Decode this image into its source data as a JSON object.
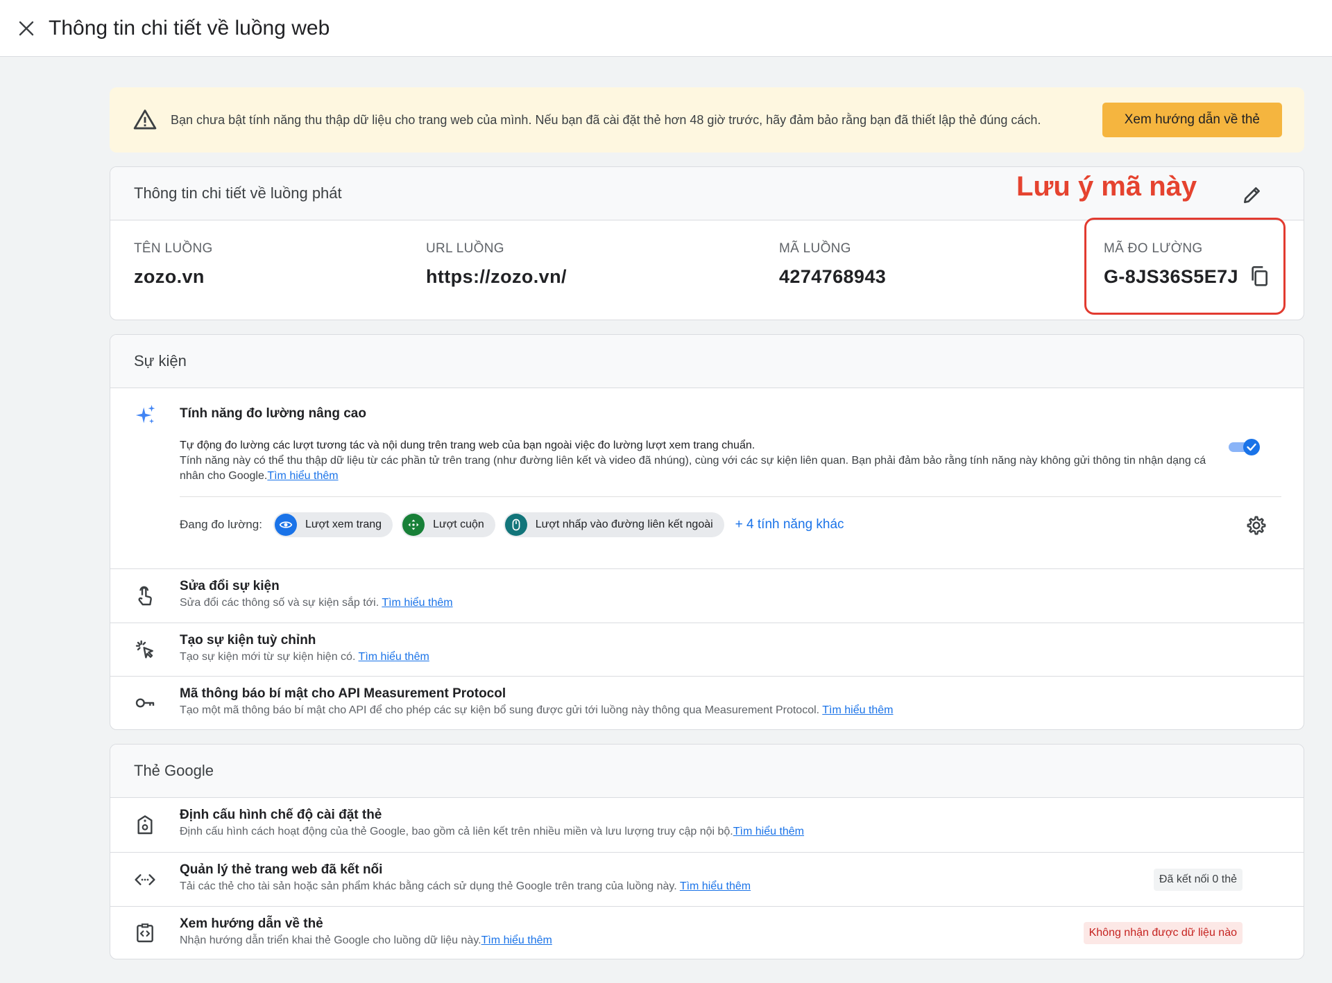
{
  "header": {
    "title": "Thông tin chi tiết về luồng web"
  },
  "banner": {
    "text": "Bạn chưa bật tính năng thu thập dữ liệu cho trang web của mình. Nếu bạn đã cài đặt thẻ hơn 48 giờ trước, hãy đảm bảo rằng bạn đã thiết lập thẻ đúng cách.",
    "button": "Xem hướng dẫn về thẻ"
  },
  "stream": {
    "title": "Thông tin chi tiết về luồng phát",
    "annotation": "Lưu ý mã này",
    "fields": [
      {
        "label": "TÊN LUỒNG",
        "value": "zozo.vn"
      },
      {
        "label": "URL LUỒNG",
        "value": "https://zozo.vn/"
      },
      {
        "label": "MÃ LUỒNG",
        "value": "4274768943"
      },
      {
        "label": "MÃ ĐO LƯỜNG",
        "value": "G-8JS36S5E7J"
      }
    ]
  },
  "events": {
    "title": "Sự kiện",
    "enhanced": {
      "title": "Tính năng đo lường nâng cao",
      "desc1": "Tự động đo lường các lượt tương tác và nội dung trên trang web của bạn ngoài việc đo lường lượt xem trang chuẩn.",
      "desc2": "Tính năng này có thể thu thập dữ liệu từ các phần tử trên trang (như đường liên kết và video đã nhúng), cùng với các sự kiện liên quan. Bạn phải đảm bảo rằng tính năng này không gửi thông tin nhận dạng cá nhân cho Google.",
      "learn_more": "Tìm hiểu thêm",
      "toggle_on": true,
      "measuring_label": "Đang đo lường:",
      "chips": [
        "Lượt xem trang",
        "Lượt cuộn",
        "Lượt nhấp vào đường liên kết ngoài"
      ],
      "more": "+ 4 tính năng khác"
    },
    "rows": [
      {
        "title": "Sửa đổi sự kiện",
        "sub": "Sửa đổi các thông số và sự kiện sắp tới.",
        "link": "Tìm hiểu thêm"
      },
      {
        "title": "Tạo sự kiện tuỳ chỉnh",
        "sub": "Tạo sự kiện mới từ sự kiện hiện có.",
        "link": "Tìm hiểu thêm"
      },
      {
        "title": "Mã thông báo bí mật cho API Measurement Protocol",
        "sub": "Tạo một mã thông báo bí mật cho API để cho phép các sự kiện bổ sung được gửi tới luồng này thông qua Measurement Protocol.",
        "link": "Tìm hiểu thêm"
      }
    ]
  },
  "google_tag": {
    "title": "Thẻ Google",
    "rows": [
      {
        "title": "Định cấu hình chế độ cài đặt thẻ",
        "sub": "Định cấu hình cách hoạt động của thẻ Google, bao gồm cả liên kết trên nhiều miền và lưu lượng truy cập nội bộ.",
        "link": "Tìm hiểu thêm"
      },
      {
        "title": "Quản lý thẻ trang web đã kết nối",
        "sub": "Tải các thẻ cho tài sản hoặc sản phẩm khác bằng cách sử dụng thẻ Google trên trang của luồng này.",
        "link": "Tìm hiểu thêm",
        "badge": "Đã kết nối 0 thẻ"
      },
      {
        "title": "Xem hướng dẫn về thẻ",
        "sub": "Nhận hướng dẫn triển khai thẻ Google cho luồng dữ liệu này.",
        "link": "Tìm hiểu thêm",
        "badge": "Không nhận được dữ liệu nào"
      }
    ]
  },
  "colors": {
    "accent": "#1a73e8",
    "warning_bg": "#fef7e0",
    "warning_button": "#f5b53f",
    "annotation_red": "#e5432f"
  }
}
